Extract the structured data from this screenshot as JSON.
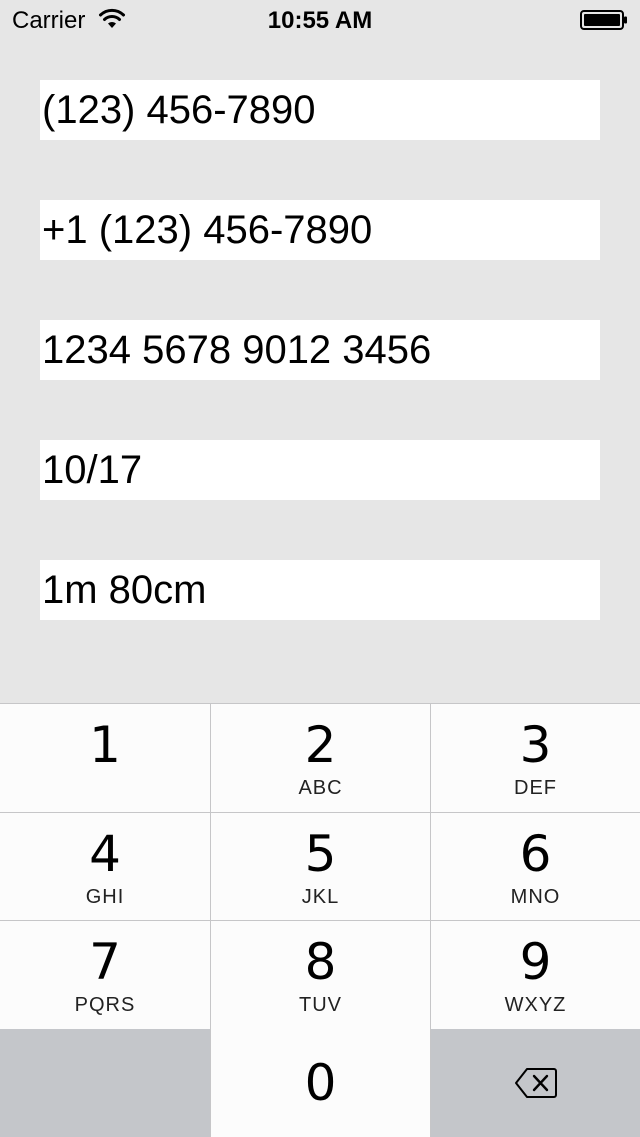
{
  "status_bar": {
    "carrier": "Carrier",
    "time": "10:55 AM",
    "wifi_icon": "wifi-icon",
    "battery_icon": "battery-full-icon"
  },
  "fields": [
    {
      "value": "(123) 456-7890"
    },
    {
      "value": "+1 (123) 456-7890"
    },
    {
      "value": "1234 5678 9012 3456"
    },
    {
      "value": "10/17"
    },
    {
      "value": "1m 80cm"
    }
  ],
  "keypad": {
    "keys": [
      {
        "digit": "1",
        "letters": ""
      },
      {
        "digit": "2",
        "letters": "ABC"
      },
      {
        "digit": "3",
        "letters": "DEF"
      },
      {
        "digit": "4",
        "letters": "GHI"
      },
      {
        "digit": "5",
        "letters": "JKL"
      },
      {
        "digit": "6",
        "letters": "MNO"
      },
      {
        "digit": "7",
        "letters": "PQRS"
      },
      {
        "digit": "8",
        "letters": "TUV"
      },
      {
        "digit": "9",
        "letters": "WXYZ"
      },
      {
        "digit": "0",
        "letters": ""
      }
    ],
    "delete_icon": "backspace-icon"
  },
  "colors": {
    "background": "#e6e6e6",
    "field_background": "#ffffff",
    "key_background": "#fcfcfc",
    "function_key_background": "#c4c6ca",
    "separator": "#c6c6c8"
  }
}
